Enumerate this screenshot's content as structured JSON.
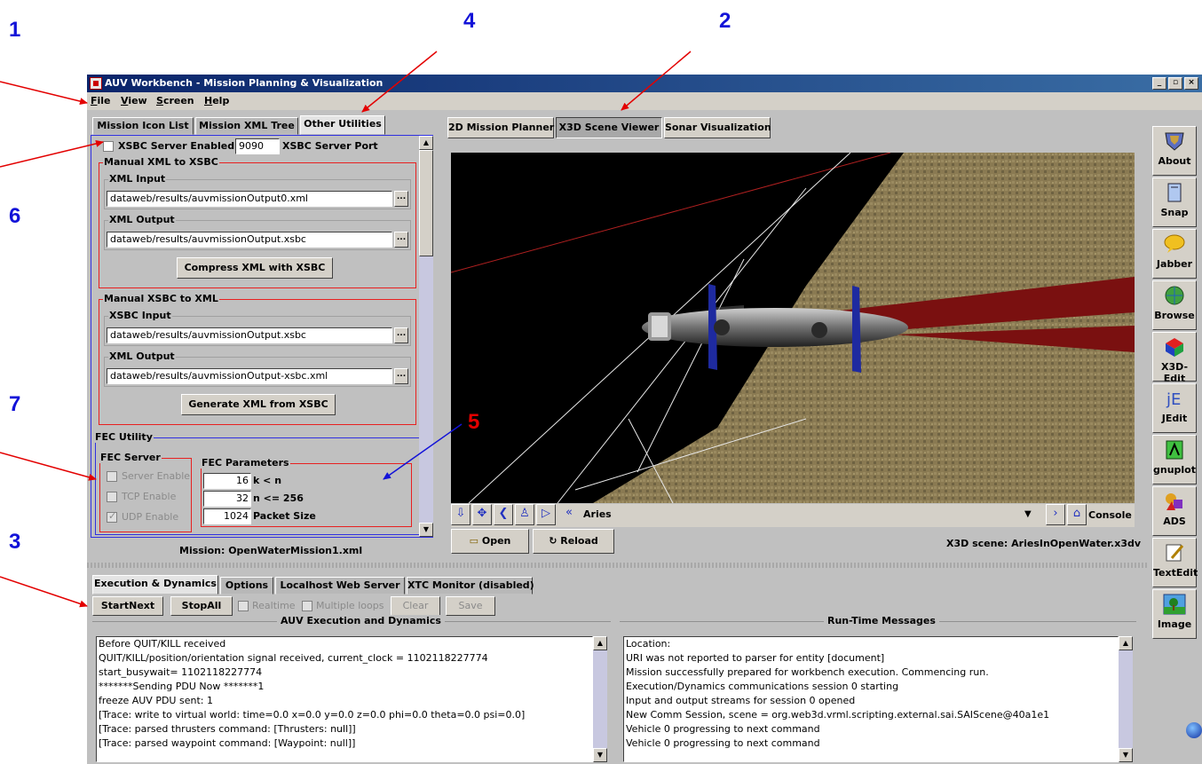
{
  "annotations": {
    "n1": "1",
    "n2": "2",
    "n3": "3",
    "n4": "4",
    "n5": "5",
    "n6": "6",
    "n7": "7"
  },
  "window": {
    "title": "AUV Workbench - Mission Planning & Visualization",
    "min": "_",
    "max": "▫",
    "close": "×"
  },
  "menu": [
    "File",
    "View",
    "Screen",
    "Help"
  ],
  "left_tabs": [
    "Mission Icon List",
    "Mission XML Tree",
    "Other Utilities"
  ],
  "xsbc": {
    "enabled_label": "XSBC Server Enabled",
    "port": "9090",
    "port_label": "XSBC Server Port"
  },
  "manual_xml_to_xsbc": {
    "title": "Manual XML to XSBC",
    "input_label": "XML Input",
    "input_value": "dataweb/results/auvmissionOutput0.xml",
    "output_label": "XML Output",
    "output_value": "dataweb/results/auvmissionOutput.xsbc",
    "button": "Compress XML with XSBC"
  },
  "manual_xsbc_to_xml": {
    "title": "Manual XSBC to XML",
    "input_label": "XSBC Input",
    "input_value": "dataweb/results/auvmissionOutput.xsbc",
    "output_label": "XML Output",
    "output_value": "dataweb/results/auvmissionOutput-xsbc.xml",
    "button": "Generate XML from XSBC"
  },
  "fec": {
    "title": "FEC Utility",
    "server_title": "FEC Server",
    "server_enable": "Server Enable",
    "tcp_enable": "TCP Enable",
    "udp_enable": "UDP Enable",
    "params_title": "FEC Parameters",
    "k_value": "16",
    "k_label": "k < n",
    "n_value": "32",
    "n_label": "n <= 256",
    "packet_value": "1024",
    "packet_label": "Packet Size"
  },
  "mission_label": "Mission:  OpenWaterMission1.xml",
  "view_tabs": [
    "2D Mission Planner",
    "X3D Scene Viewer",
    "Sonar Visualization"
  ],
  "viewer": {
    "viewpoint": "Aries",
    "console": "Console",
    "open": "Open",
    "reload": "Reload",
    "scene": "X3D scene:  AriesInOpenWater.x3dv",
    "dots": "...",
    "dropdown_arrow": "▼"
  },
  "right_toolbar": [
    "About",
    "Snap",
    "Jabber",
    "Browse",
    "X3D-Edit",
    "JEdit",
    "gnuplot",
    "ADS",
    "TextEdit",
    "Image"
  ],
  "bottom_tabs": [
    "Execution & Dynamics",
    "Options",
    "Localhost Web Server",
    "XTC Monitor (disabled)"
  ],
  "exec_controls": {
    "start": "StartNext",
    "stop": "StopAll",
    "realtime": "Realtime",
    "multiple": "Multiple loops",
    "clear": "Clear",
    "save": "Save"
  },
  "exec_panel": {
    "title": "AUV Execution and Dynamics",
    "lines": [
      "Before QUIT/KILL received",
      "QUIT/KILL/position/orientation signal received, current_clock = 1102118227774",
      "start_busywait= 1102118227774",
      "*******Sending PDU Now *******1",
      "freeze AUV PDU sent:  1",
      "[Trace: write to virtual world: time=0.0 x=0.0 y=0.0 z=0.0 phi=0.0 theta=0.0 psi=0.0]",
      "[Trace: parsed thrusters command: [Thrusters: null]]",
      "[Trace: parsed waypoint command: [Waypoint: null]]"
    ]
  },
  "runtime_panel": {
    "title": "Run-Time Messages",
    "lines": [
      "   Location:",
      "URI was not reported to parser for entity [document]",
      "Mission successfully prepared for workbench execution. Commencing run.",
      "Execution/Dynamics communications session 0 starting",
      "Input and output streams for session 0 opened",
      "New Comm Session, scene = org.web3d.vrml.scripting.external.sai.SAIScene@40a1e1",
      "Vehicle 0 progressing to next command",
      "Vehicle 0 progressing to next command"
    ]
  },
  "colors": {
    "titlebar": "#0a246a",
    "annotation_blue": "#1212d8",
    "annotation_red": "#e30000",
    "seafloor": "#8a7a52",
    "beam": "#7a1010"
  }
}
